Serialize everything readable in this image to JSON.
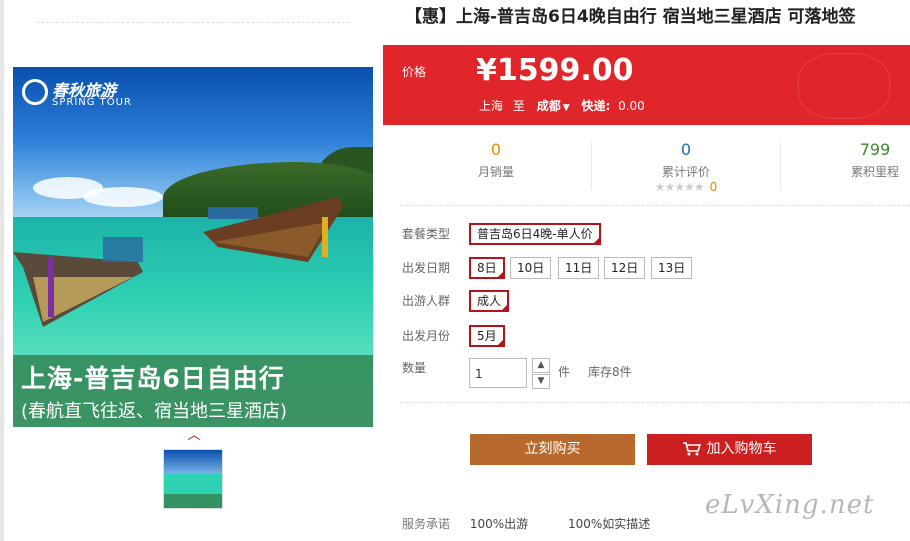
{
  "product": {
    "title": "【惠】上海-普吉岛6日4晚自由行 宿当地三星酒店 可落地签",
    "image": {
      "logo_cn": "春秋旅游",
      "logo_en": "SPRING TOUR",
      "caption_main": "上海-普吉岛6日自由行",
      "caption_sub": "(春航直飞往返、宿当地三星酒店)"
    }
  },
  "price": {
    "label": "价格",
    "value": "¥1599.00",
    "from_city": "上海",
    "to_word": "至",
    "to_city": "成都",
    "shipping_label": "快递:",
    "shipping_value": "0.00"
  },
  "stats": {
    "monthly_sales": {
      "num": "0",
      "label": "月销量"
    },
    "reviews": {
      "num": "0",
      "label": "累计评价",
      "stars": "★★★★★",
      "star_count": "0"
    },
    "mileage": {
      "num": "799",
      "label": "累积里程"
    }
  },
  "options": {
    "package": {
      "label": "套餐类型",
      "choices": [
        "普吉岛6日4晚-单人价"
      ]
    },
    "date": {
      "label": "出发日期",
      "choices": [
        "8日",
        "10日",
        "11日",
        "12日",
        "13日"
      ]
    },
    "crowd": {
      "label": "出游人群",
      "choices": [
        "成人"
      ]
    },
    "month": {
      "label": "出发月份",
      "choices": [
        "5月"
      ]
    },
    "quantity": {
      "label": "数量",
      "value": "1",
      "unit": "件",
      "stock": "库存8件",
      "up": "▲",
      "down": "▼"
    }
  },
  "buttons": {
    "buy": "立刻购买",
    "cart": "加入购物车"
  },
  "promise": {
    "label": "服务承诺",
    "items": [
      "100%出游",
      "100%如实描述"
    ]
  },
  "watermark": "eLvXing.net",
  "colors": {
    "price_bg": "#e0262b",
    "buy": "#b86a2e",
    "cart": "#cc1f1f",
    "select_border": "#b0151b"
  }
}
